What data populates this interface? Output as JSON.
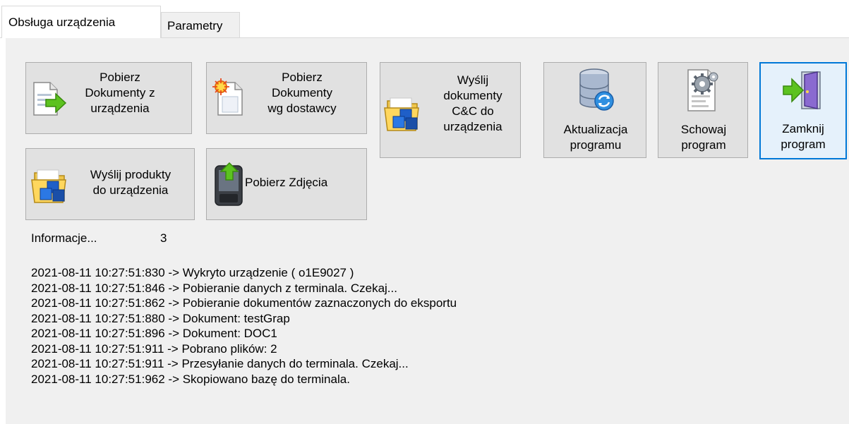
{
  "tabs": [
    {
      "label": "Obsługa urządzenia",
      "active": true
    },
    {
      "label": "Parametry",
      "active": false
    }
  ],
  "buttons": {
    "pobierz_dokumenty": {
      "label": "Pobierz\nDokumenty z\nurządzenia",
      "icon": "document-import-icon"
    },
    "pobierz_dostawcy": {
      "label": "Pobierz\nDokumenty\nwg dostawcy",
      "icon": "document-star-icon"
    },
    "wyslij_dokumenty": {
      "label": "Wyślij\ndokumenty\nC&C do\nurządzenia",
      "icon": "folder-cubes-icon"
    },
    "aktualizacja": {
      "label": "Aktualizacja\nprogramu",
      "icon": "database-sync-icon"
    },
    "schowaj": {
      "label": "Schowaj\nprogram",
      "icon": "gear-document-icon"
    },
    "zamknij": {
      "label": "Zamknij\nprogram",
      "icon": "exit-door-icon"
    },
    "wyslij_produkty": {
      "label": "Wyślij produkty\ndo urządzenia",
      "icon": "folder-cubes-icon"
    },
    "pobierz_zdjecia": {
      "label": "Pobierz Zdjęcia",
      "icon": "device-upload-icon"
    }
  },
  "info": {
    "label": "Informacje...",
    "count": "3"
  },
  "log": [
    "2021-08-11 10:27:51:830 -> Wykryto urządzenie ( o1E9027 )",
    "2021-08-11 10:27:51:846 -> Pobieranie danych z terminala. Czekaj...",
    "2021-08-11 10:27:51:862 -> Pobieranie dokumentów zaznaczonych do eksportu",
    "2021-08-11 10:27:51:880 -> Dokument: testGrap",
    "2021-08-11 10:27:51:896 -> Dokument: DOC1",
    "2021-08-11 10:27:51:911 -> Pobrano plików: 2",
    "2021-08-11 10:27:51:911 -> Przesyłanie danych do terminala. Czekaj...",
    "2021-08-11 10:27:51:962 -> Skopiowano bazę do terminala."
  ],
  "colors": {
    "focus_border": "#0078d7",
    "button_face": "#e1e1e1",
    "panel": "#f0f0f0"
  }
}
